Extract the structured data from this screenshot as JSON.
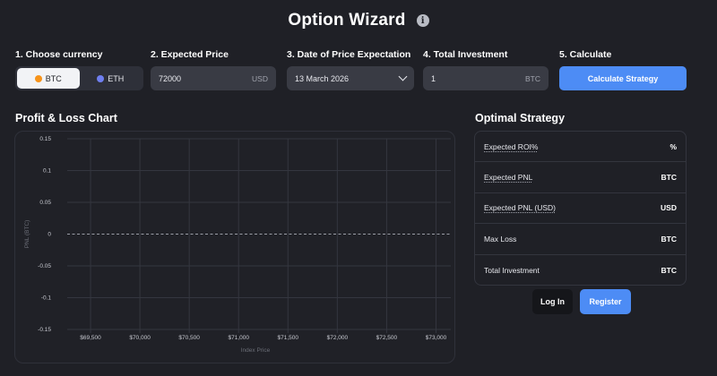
{
  "header": {
    "title": "Option Wizard",
    "info_icon": "info-icon"
  },
  "steps": {
    "currency": {
      "label": "1. Choose currency",
      "options": [
        {
          "label": "BTC",
          "icon": "btc-coin-icon",
          "selected": true
        },
        {
          "label": "ETH",
          "icon": "eth-coin-icon",
          "selected": false
        }
      ]
    },
    "expected_price": {
      "label": "2. Expected Price",
      "value": "72000",
      "unit": "USD"
    },
    "date": {
      "label": "3. Date of Price Expectation",
      "value": "13 March 2026"
    },
    "investment": {
      "label": "4. Total Investment",
      "value": "1",
      "unit": "BTC"
    },
    "calculate": {
      "label": "5. Calculate",
      "button": "Calculate Strategy"
    }
  },
  "chart_section": {
    "title": "Profit & Loss Chart"
  },
  "chart_data": {
    "type": "line",
    "xlabel": "Index Price",
    "ylabel": "PNL (BTC)",
    "x_ticks": [
      "$69,500",
      "$70,000",
      "$70,500",
      "$71,000",
      "$71,500",
      "$72,000",
      "$72,500",
      "$73,000"
    ],
    "x_tick_values": [
      69500,
      70000,
      70500,
      71000,
      71500,
      72000,
      72500,
      73000
    ],
    "y_ticks": [
      "0.15",
      "0.1",
      "0.05",
      "0",
      "-0.05",
      "-0.1",
      "-0.15"
    ],
    "y_tick_values": [
      0.15,
      0.1,
      0.05,
      0,
      -0.05,
      -0.1,
      -0.15
    ],
    "xlim": [
      69300,
      73150
    ],
    "ylim": [
      -0.15,
      0.15
    ],
    "zero_line": 0,
    "grid": true,
    "series": []
  },
  "strategy": {
    "title": "Optimal Strategy",
    "rows": [
      {
        "label": "Expected ROI%",
        "unit": "%"
      },
      {
        "label": "Expected PNL",
        "unit": "BTC"
      },
      {
        "label": "Expected PNL (USD)",
        "unit": "USD"
      },
      {
        "label": "Max Loss",
        "unit": "BTC"
      },
      {
        "label": "Total Investment",
        "unit": "BTC"
      }
    ]
  },
  "auth": {
    "login": "Log In",
    "register": "Register"
  },
  "colors": {
    "background": "#1f2026",
    "accent": "#4d8cf5",
    "btc": "#f7931a",
    "eth": "#6f7ff0"
  }
}
